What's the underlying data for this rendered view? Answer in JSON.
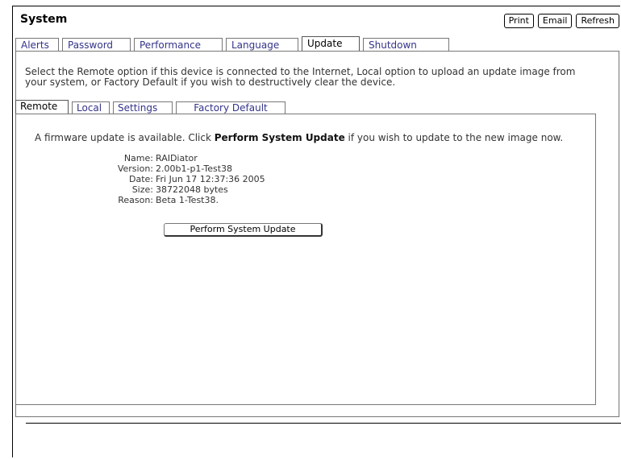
{
  "window": {
    "title": "System"
  },
  "header_buttons": {
    "print": "Print",
    "email": "Email",
    "refresh": "Refresh"
  },
  "tabs": [
    {
      "label": "Alerts",
      "active": false
    },
    {
      "label": "Password",
      "active": false
    },
    {
      "label": "Performance",
      "active": false
    },
    {
      "label": "Language",
      "active": false
    },
    {
      "label": "Update",
      "active": true
    },
    {
      "label": "Shutdown",
      "active": false
    }
  ],
  "update": {
    "intro": "Select the Remote option if this device is connected to the Internet, Local option to upload an update image from your system, or Factory Default if you wish to destructively clear the device.",
    "subtabs": [
      {
        "label": "Remote",
        "active": true
      },
      {
        "label": "Local",
        "active": false
      },
      {
        "label": "Settings",
        "active": false
      },
      {
        "label": "Factory Default",
        "active": false
      }
    ],
    "remote": {
      "avail_pre": "A firmware update is available. Click ",
      "avail_bold": "Perform System Update",
      "avail_post": " if you wish to update to the new image now.",
      "info": [
        {
          "label": "Name:",
          "value": "RAIDiator"
        },
        {
          "label": "Version:",
          "value": "2.00b1-p1-Test38"
        },
        {
          "label": "Date:",
          "value": "Fri Jun 17 12:37:36 2005"
        },
        {
          "label": "Size:",
          "value": "38722048 bytes"
        },
        {
          "label": "Reason:",
          "value": "Beta 1-Test38."
        }
      ],
      "button": "Perform System Update"
    }
  }
}
